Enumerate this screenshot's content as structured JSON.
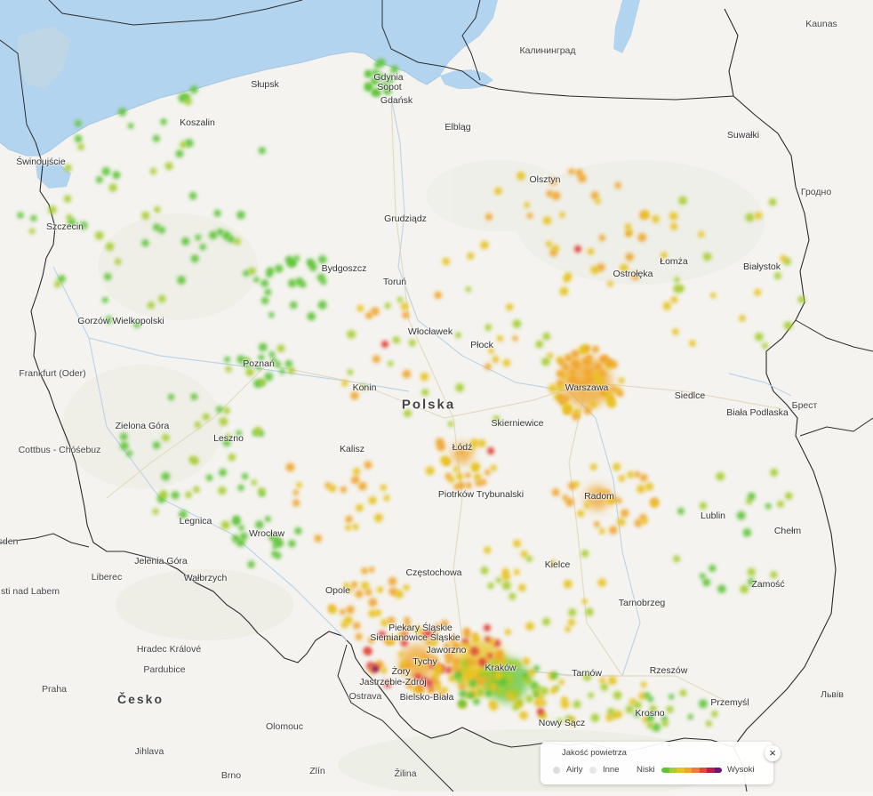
{
  "map": {
    "country_label": "Polska",
    "other_countries": [
      {
        "text": "Česko"
      }
    ],
    "cities_pl": [
      "Świnoujście",
      "Koszalin",
      "Słupsk",
      "Gdynia",
      "Sopot",
      "Gdańsk",
      "Elbląg",
      "Olsztyn",
      "Suwałki",
      "Szczecin",
      "Grudziądz",
      "Bydgoszcz",
      "Toruń",
      "Ostrołęka",
      "Łomża",
      "Białystok",
      "Gorzów Wielkopolski",
      "Włocławek",
      "Płock",
      "Warszawa",
      "Poznań",
      "Konin",
      "Skierniewice",
      "Siedlce",
      "Biała Podlaska",
      "Zielona Góra",
      "Leszno",
      "Łódź",
      "Kalisz",
      "Piotrków Trybunalski",
      "Radom",
      "Lublin",
      "Legnica",
      "Wrocław",
      "Jelenia Góra",
      "Wałbrzych",
      "Chełm",
      "Opole",
      "Częstochowa",
      "Kielce",
      "Zamość",
      "Tarnobrzeg",
      "Piekary Śląskie",
      "Siemianowice Śląskie",
      "Jaworzno",
      "Tychy",
      "Kraków",
      "Żory",
      "Jastrzębie-Zdrój",
      "Tarnów",
      "Rzeszów",
      "Bielsko-Biała",
      "Nowy Sącz",
      "Krosno",
      "Przemyśl"
    ],
    "cities_foreign": [
      "Kaunas",
      "Калининград",
      "Гродно",
      "Брест",
      "Frankfurt (Oder)",
      "Cottbus - Chóśebuz",
      "sden",
      "Liberec",
      "sti nad Labem",
      "Hradec Králové",
      "Praha",
      "Pardubice",
      "Ostrava",
      "Olomouc",
      "Jihlava",
      "Brno",
      "Zlín",
      "Žilina",
      "Львів"
    ],
    "colors": {
      "land": "#f6f5f2",
      "water": "#aed0ec",
      "border": "#2d2d2d",
      "very_low": "#5ec437",
      "low": "#a6cd2f",
      "medium": "#e8c21e",
      "high": "#f0a52a",
      "very_high": "#e2473a",
      "extreme": "#8d1c6c"
    }
  },
  "legend": {
    "title": "Jakość powietrza",
    "airly": "Airly",
    "inne": "Inne",
    "niski": "Niski",
    "wysoki": "Wysoki",
    "close": "×",
    "scale_colors": [
      "#5ec437",
      "#a6cd2f",
      "#e8c21e",
      "#f0a52a",
      "#ef7b3a",
      "#e2473a",
      "#b81f4f",
      "#6b137a"
    ]
  }
}
